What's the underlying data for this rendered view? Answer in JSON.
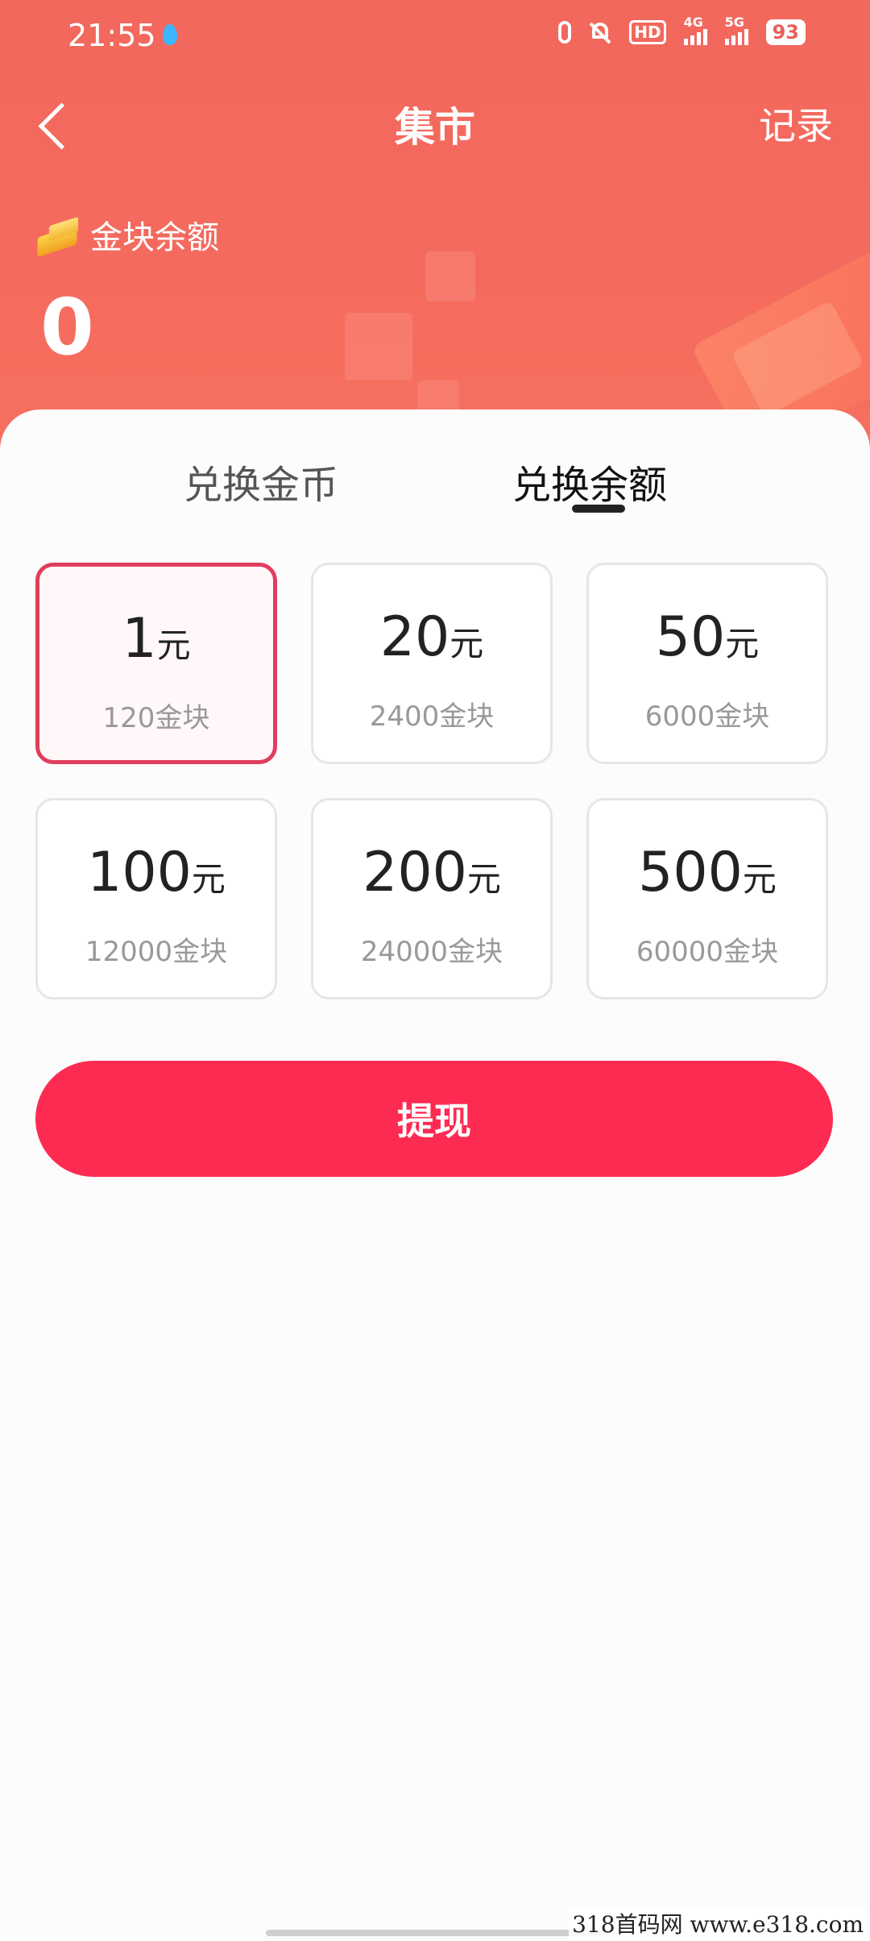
{
  "status_bar": {
    "time": "21:55",
    "hd_label": "HD",
    "signal1_label": "4G",
    "signal2_label": "5G",
    "battery": "93"
  },
  "nav": {
    "title": "集市",
    "record": "记录"
  },
  "balance": {
    "label": "金块余额",
    "value": "0"
  },
  "tabs": [
    {
      "label": "兑换金币",
      "active": false
    },
    {
      "label": "兑换余额",
      "active": true
    }
  ],
  "options": [
    {
      "amount": "1",
      "unit": "元",
      "cost": "120金块",
      "selected": true
    },
    {
      "amount": "20",
      "unit": "元",
      "cost": "2400金块",
      "selected": false
    },
    {
      "amount": "50",
      "unit": "元",
      "cost": "6000金块",
      "selected": false
    },
    {
      "amount": "100",
      "unit": "元",
      "cost": "12000金块",
      "selected": false
    },
    {
      "amount": "200",
      "unit": "元",
      "cost": "24000金块",
      "selected": false
    },
    {
      "amount": "500",
      "unit": "元",
      "cost": "60000金块",
      "selected": false
    }
  ],
  "withdraw_button": "提现",
  "watermark": "318首码网 www.e318.com",
  "colors": {
    "header": "#f56a5e",
    "accent": "#fd2b52",
    "selected_border": "#e03e5e"
  }
}
